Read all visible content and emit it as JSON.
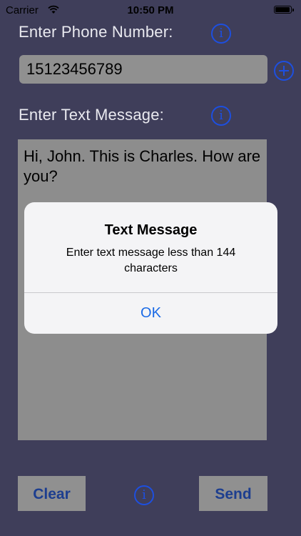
{
  "status_bar": {
    "carrier": "Carrier",
    "time": "10:50 PM"
  },
  "form": {
    "phone_label": "Enter Phone Number:",
    "phone_value": "15123456789",
    "message_label": "Enter Text Message:",
    "message_value": "Hi, John. This is Charles. How are you?",
    "info_glyph": "i"
  },
  "buttons": {
    "clear": "Clear",
    "send": "Send"
  },
  "alert": {
    "title": "Text Message",
    "message": "Enter text message less than 144 characters",
    "ok": "OK"
  },
  "colors": {
    "background": "#3f3e5a",
    "accent": "#1d4fe0",
    "button_text": "#1d3e8f",
    "alert_action": "#1a6ae6"
  },
  "icons": {
    "info": "info-icon",
    "add": "plus-circle-icon",
    "wifi": "wifi-icon",
    "battery": "battery-icon"
  }
}
